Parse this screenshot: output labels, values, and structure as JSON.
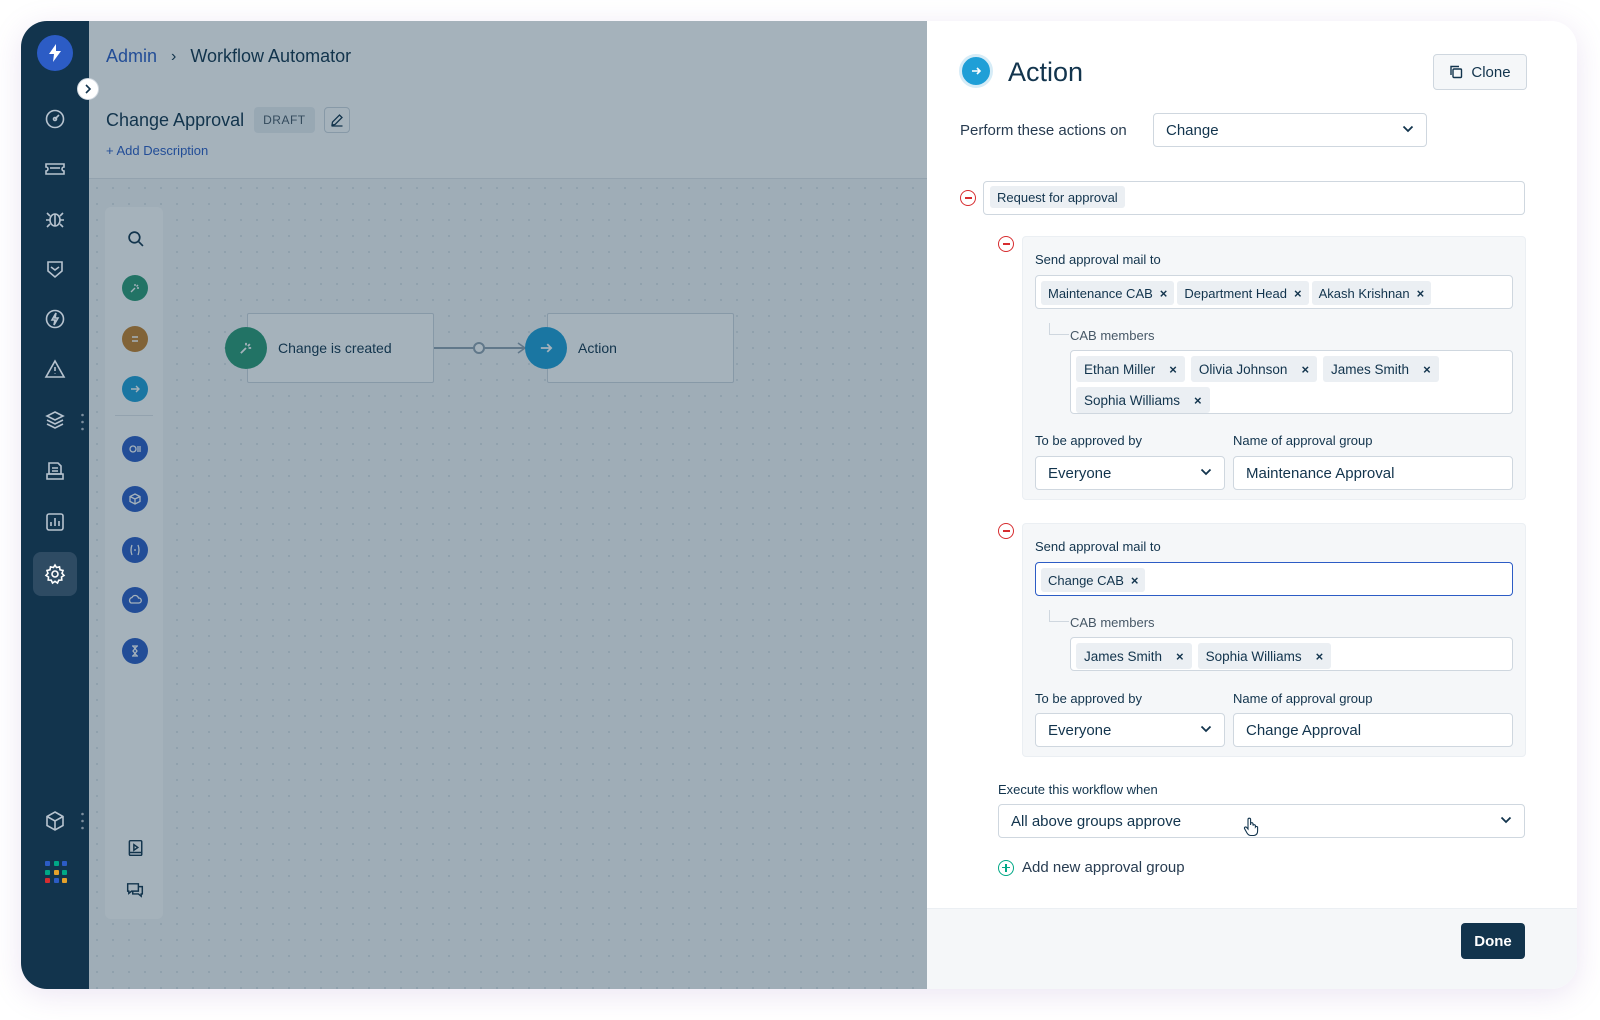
{
  "breadcrumb": {
    "parent": "Admin",
    "separator": "›",
    "current": "Workflow Automator"
  },
  "workflow": {
    "title": "Change Approval",
    "status_badge": "DRAFT",
    "add_description": "+ Add Description"
  },
  "canvas": {
    "trigger_node": {
      "label": "Change is created",
      "icon": "trigger-icon",
      "color": "#2d9a74"
    },
    "action_node": {
      "label": "Action",
      "icon": "action-icon",
      "color": "#1f9fd7"
    }
  },
  "palette": {
    "items": [
      {
        "name": "search-icon"
      },
      {
        "name": "event-icon",
        "color": "#2d9a74"
      },
      {
        "name": "condition-icon",
        "color": "#c6802a"
      },
      {
        "name": "action-icon",
        "color": "#1f9fd7"
      },
      {
        "name": "reader-icon",
        "color": "#2c5cc5"
      },
      {
        "name": "app-icon",
        "color": "#2c5cc5"
      },
      {
        "name": "expression-icon",
        "color": "#2c5cc5"
      },
      {
        "name": "web-request-icon",
        "color": "#2c5cc5"
      },
      {
        "name": "timer-icon",
        "color": "#2c5cc5"
      }
    ]
  },
  "panel": {
    "title": "Action",
    "clone_label": "Clone",
    "perform_label": "Perform these actions on",
    "perform_value": "Change",
    "action_type_tag": "Request for approval",
    "groups": [
      {
        "send_label": "Send approval mail to",
        "recipients": [
          "Maintenance CAB",
          "Department Head",
          "Akash Krishnan"
        ],
        "cab_label": "CAB members",
        "cab_members": [
          "Ethan Miller",
          "Olivia Johnson",
          "James Smith",
          "Sophia Williams"
        ],
        "approved_by_label": "To be approved by",
        "approved_by_value": "Everyone",
        "group_name_label": "Name of approval group",
        "group_name_value": "Maintenance Approval"
      },
      {
        "send_label": "Send approval mail to",
        "recipients": [
          "Change CAB"
        ],
        "cab_label": "CAB members",
        "cab_members": [
          "James Smith",
          "Sophia Williams"
        ],
        "approved_by_label": "To be approved by",
        "approved_by_value": "Everyone",
        "group_name_label": "Name of approval group",
        "group_name_value": "Change Approval"
      }
    ],
    "execute_label": "Execute this workflow when",
    "execute_value": "All above groups approve",
    "add_group_label": "Add new approval group",
    "done_label": "Done"
  },
  "sidebar": {
    "items": [
      "dashboard-icon",
      "tickets-icon",
      "problems-icon",
      "changes-icon",
      "releases-icon",
      "alerts-icon",
      "assets-icon",
      "solutions-icon",
      "reports-icon",
      "admin-settings-icon"
    ],
    "active": "admin-settings-icon",
    "bottom": [
      "marketplace-icon",
      "apps-grid-icon"
    ]
  },
  "colors": {
    "navy": "#12344d",
    "accent_blue": "#2c5cc5",
    "action_blue": "#1f9fd7",
    "danger": "#d72d30",
    "success": "#00a886"
  }
}
